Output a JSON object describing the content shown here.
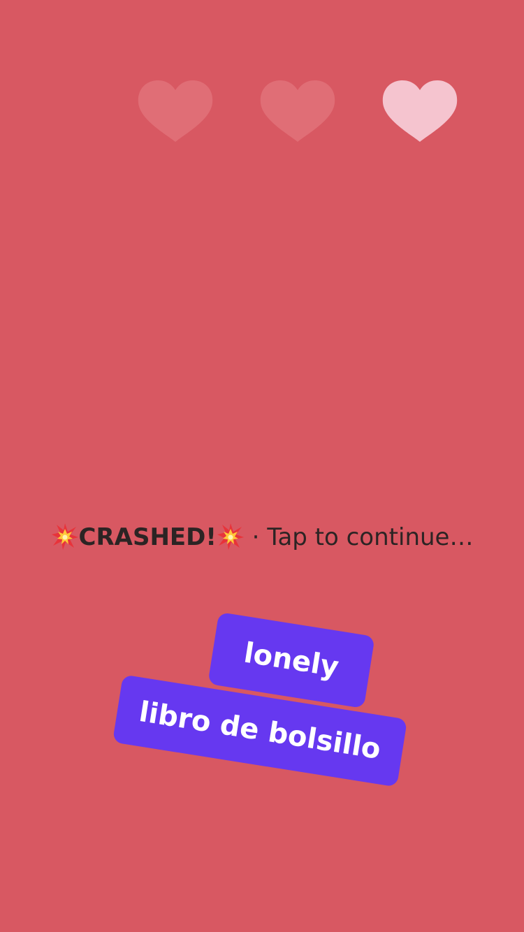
{
  "lives": {
    "total": 3,
    "remaining": 1,
    "hearts": [
      {
        "state": "lost",
        "color": "#e06e76"
      },
      {
        "state": "lost",
        "color": "#e06e76"
      },
      {
        "state": "active",
        "color": "#f5c4cf"
      }
    ]
  },
  "status": {
    "emoji_icon": "collision-icon",
    "crash_label": "CRASHED!",
    "separator": " · ",
    "continue_label": "Tap to continue…"
  },
  "word_cards": [
    {
      "label": "lonely",
      "color": "#6638f0"
    },
    {
      "label": "libro de bolsillo",
      "color": "#6638f0"
    }
  ],
  "colors": {
    "background": "#d85862",
    "card": "#6638f0",
    "text": "#2c2424"
  }
}
